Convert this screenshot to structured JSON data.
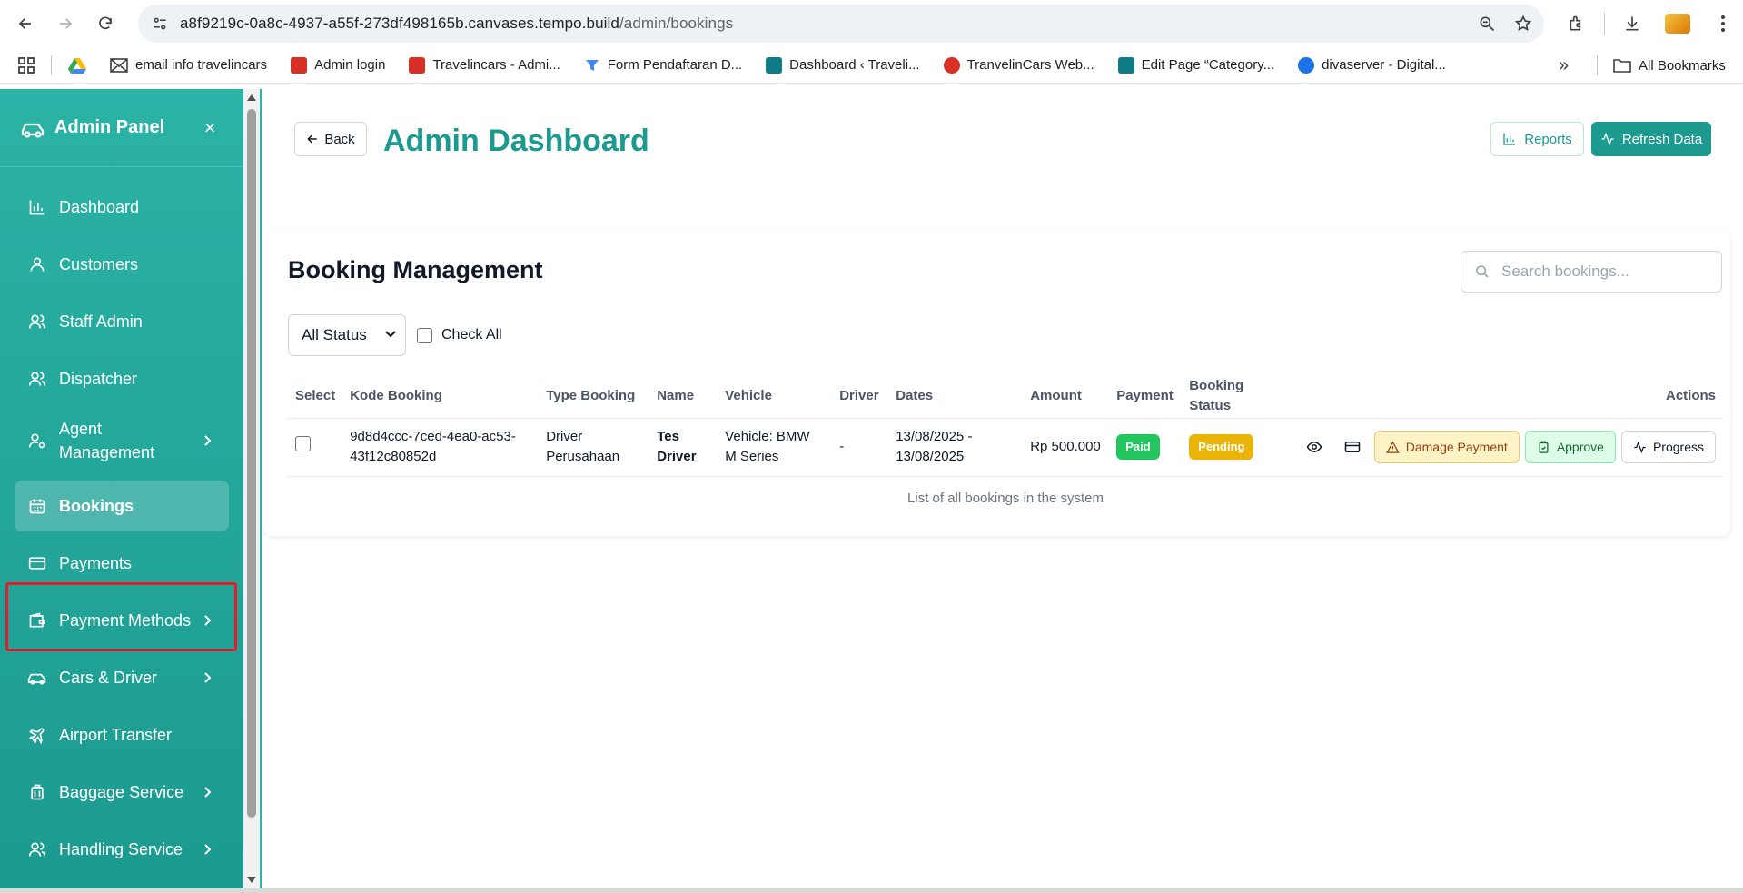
{
  "browser": {
    "url_host": "a8f9219c-0a8c-4937-a55f-273df498165b.canvases.tempo.build",
    "url_path": "/admin/bookings",
    "bookmarks": [
      {
        "label": "",
        "color": "#34a853",
        "icon": "drive-icon"
      },
      {
        "label": "email info travelincars",
        "color": "#ffffff",
        "icon": "mail-icon"
      },
      {
        "label": "Admin login",
        "color": "#d93025",
        "icon": "site-favicon"
      },
      {
        "label": "Travelincars - Admi...",
        "color": "#d93025",
        "icon": "site-favicon"
      },
      {
        "label": "Form Pendaftaran D...",
        "color": "#4285f4",
        "icon": "form-favicon"
      },
      {
        "label": "Dashboard ‹ Traveli...",
        "color": "#0e7c86",
        "icon": "site-favicon"
      },
      {
        "label": "TranvelinCars Web...",
        "color": "#d93025",
        "icon": "site-favicon"
      },
      {
        "label": "Edit Page “Category...",
        "color": "#0e7c86",
        "icon": "site-favicon"
      },
      {
        "label": "divaserver - Digital...",
        "color": "#1a73e8",
        "icon": "site-favicon"
      }
    ],
    "all_bookmarks": "All Bookmarks",
    "more_symbol": "»"
  },
  "sidebar": {
    "title": "Admin Panel",
    "close_symbol": "×",
    "items": [
      {
        "label": "Dashboard",
        "icon": "bar-chart-icon",
        "chevron": false,
        "active": false
      },
      {
        "label": "Customers",
        "icon": "user-icon",
        "chevron": false,
        "active": false
      },
      {
        "label": "Staff Admin",
        "icon": "users-icon",
        "chevron": false,
        "active": false
      },
      {
        "label": "Dispatcher",
        "icon": "users-icon",
        "chevron": false,
        "active": false
      },
      {
        "label": "Agent Management",
        "icon": "user-cog-icon",
        "chevron": true,
        "active": false
      },
      {
        "label": "Bookings",
        "icon": "calendar-icon",
        "chevron": false,
        "active": true
      },
      {
        "label": "Payments",
        "icon": "credit-card-icon",
        "chevron": false,
        "active": false
      },
      {
        "label": "Payment Methods",
        "icon": "wallet-icon",
        "chevron": true,
        "active": false
      },
      {
        "label": "Cars & Driver",
        "icon": "car-icon",
        "chevron": true,
        "active": false
      },
      {
        "label": "Airport Transfer",
        "icon": "plane-icon",
        "chevron": false,
        "active": false
      },
      {
        "label": "Baggage Service",
        "icon": "luggage-icon",
        "chevron": true,
        "active": false
      },
      {
        "label": "Handling Service",
        "icon": "users-icon",
        "chevron": true,
        "active": false
      }
    ]
  },
  "header": {
    "back_label": "Back",
    "title": "Admin Dashboard",
    "reports_label": "Reports",
    "refresh_label": "Refresh Data"
  },
  "bookings": {
    "section_title": "Booking Management",
    "search_placeholder": "Search bookings...",
    "status_filter": "All Status",
    "check_all_label": "Check All",
    "columns": [
      "Select",
      "Kode Booking",
      "Type Booking",
      "Name",
      "Vehicle",
      "Driver",
      "Dates",
      "Amount",
      "Payment",
      "Booking Status",
      "",
      "Actions"
    ],
    "rows": [
      {
        "kode_booking_line1": "9d8d4ccc-7ced-4ea0-ac53-",
        "kode_booking_line2": "43f12c80852d",
        "type_line1": "Driver",
        "type_line2": "Perusahaan",
        "name_line1": "Tes",
        "name_line2": "Driver",
        "vehicle_line1": "Vehicle: BMW",
        "vehicle_line2": "M Series",
        "driver": "-",
        "dates_line1": "13/08/2025 -",
        "dates_line2": "13/08/2025",
        "amount": "Rp 500.000",
        "payment": "Paid",
        "booking_status": "Pending",
        "actions": {
          "damage": "Damage Payment",
          "approve": "Approve",
          "progress": "Progress"
        }
      }
    ],
    "caption": "List of all bookings in the system"
  },
  "colors": {
    "brand": "#1c9a8f",
    "paid": "#22c55e",
    "pending": "#eab308",
    "highlight": "#e11d2e"
  }
}
